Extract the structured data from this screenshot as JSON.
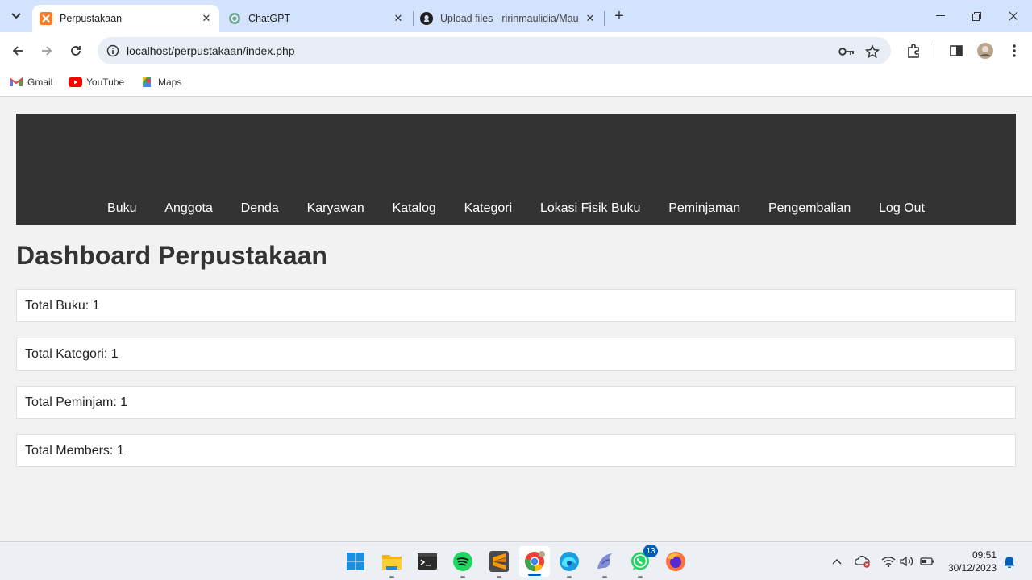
{
  "browser": {
    "tabs": [
      {
        "title": "Perpustakaan",
        "icon": "xampp-favicon-icon",
        "active": true
      },
      {
        "title": "ChatGPT",
        "icon": "chatgpt-favicon-icon",
        "active": false
      },
      {
        "title": "Upload files · ririnmaulidia/Mau",
        "icon": "github-favicon-icon",
        "active": false
      }
    ],
    "url": "localhost/perpustakaan/index.php",
    "bookmarks": [
      {
        "label": "Gmail",
        "icon": "gmail-icon"
      },
      {
        "label": "YouTube",
        "icon": "youtube-icon"
      },
      {
        "label": "Maps",
        "icon": "maps-icon"
      }
    ]
  },
  "page": {
    "nav": [
      "Buku",
      "Anggota",
      "Denda",
      "Karyawan",
      "Katalog",
      "Kategori",
      "Lokasi Fisik Buku",
      "Peminjaman",
      "Pengembalian",
      "Log Out"
    ],
    "title": "Dashboard Perpustakaan",
    "stats": [
      "Total Buku: 1",
      "Total Kategori: 1",
      "Total Peminjam: 1",
      "Total Members: 1"
    ]
  },
  "taskbar": {
    "apps": [
      "windows-start-icon",
      "file-explorer-icon",
      "terminal-icon",
      "spotify-icon",
      "sublime-text-icon",
      "chrome-icon",
      "edge-icon",
      "dolphin-icon",
      "whatsapp-icon",
      "firefox-icon"
    ],
    "whatsapp_badge": "13",
    "time": "09:51",
    "date": "30/12/2023"
  },
  "colors": {
    "header_bg": "#333333",
    "page_bg": "#f2f2f2",
    "tabstrip_bg": "#d3e3fd"
  }
}
